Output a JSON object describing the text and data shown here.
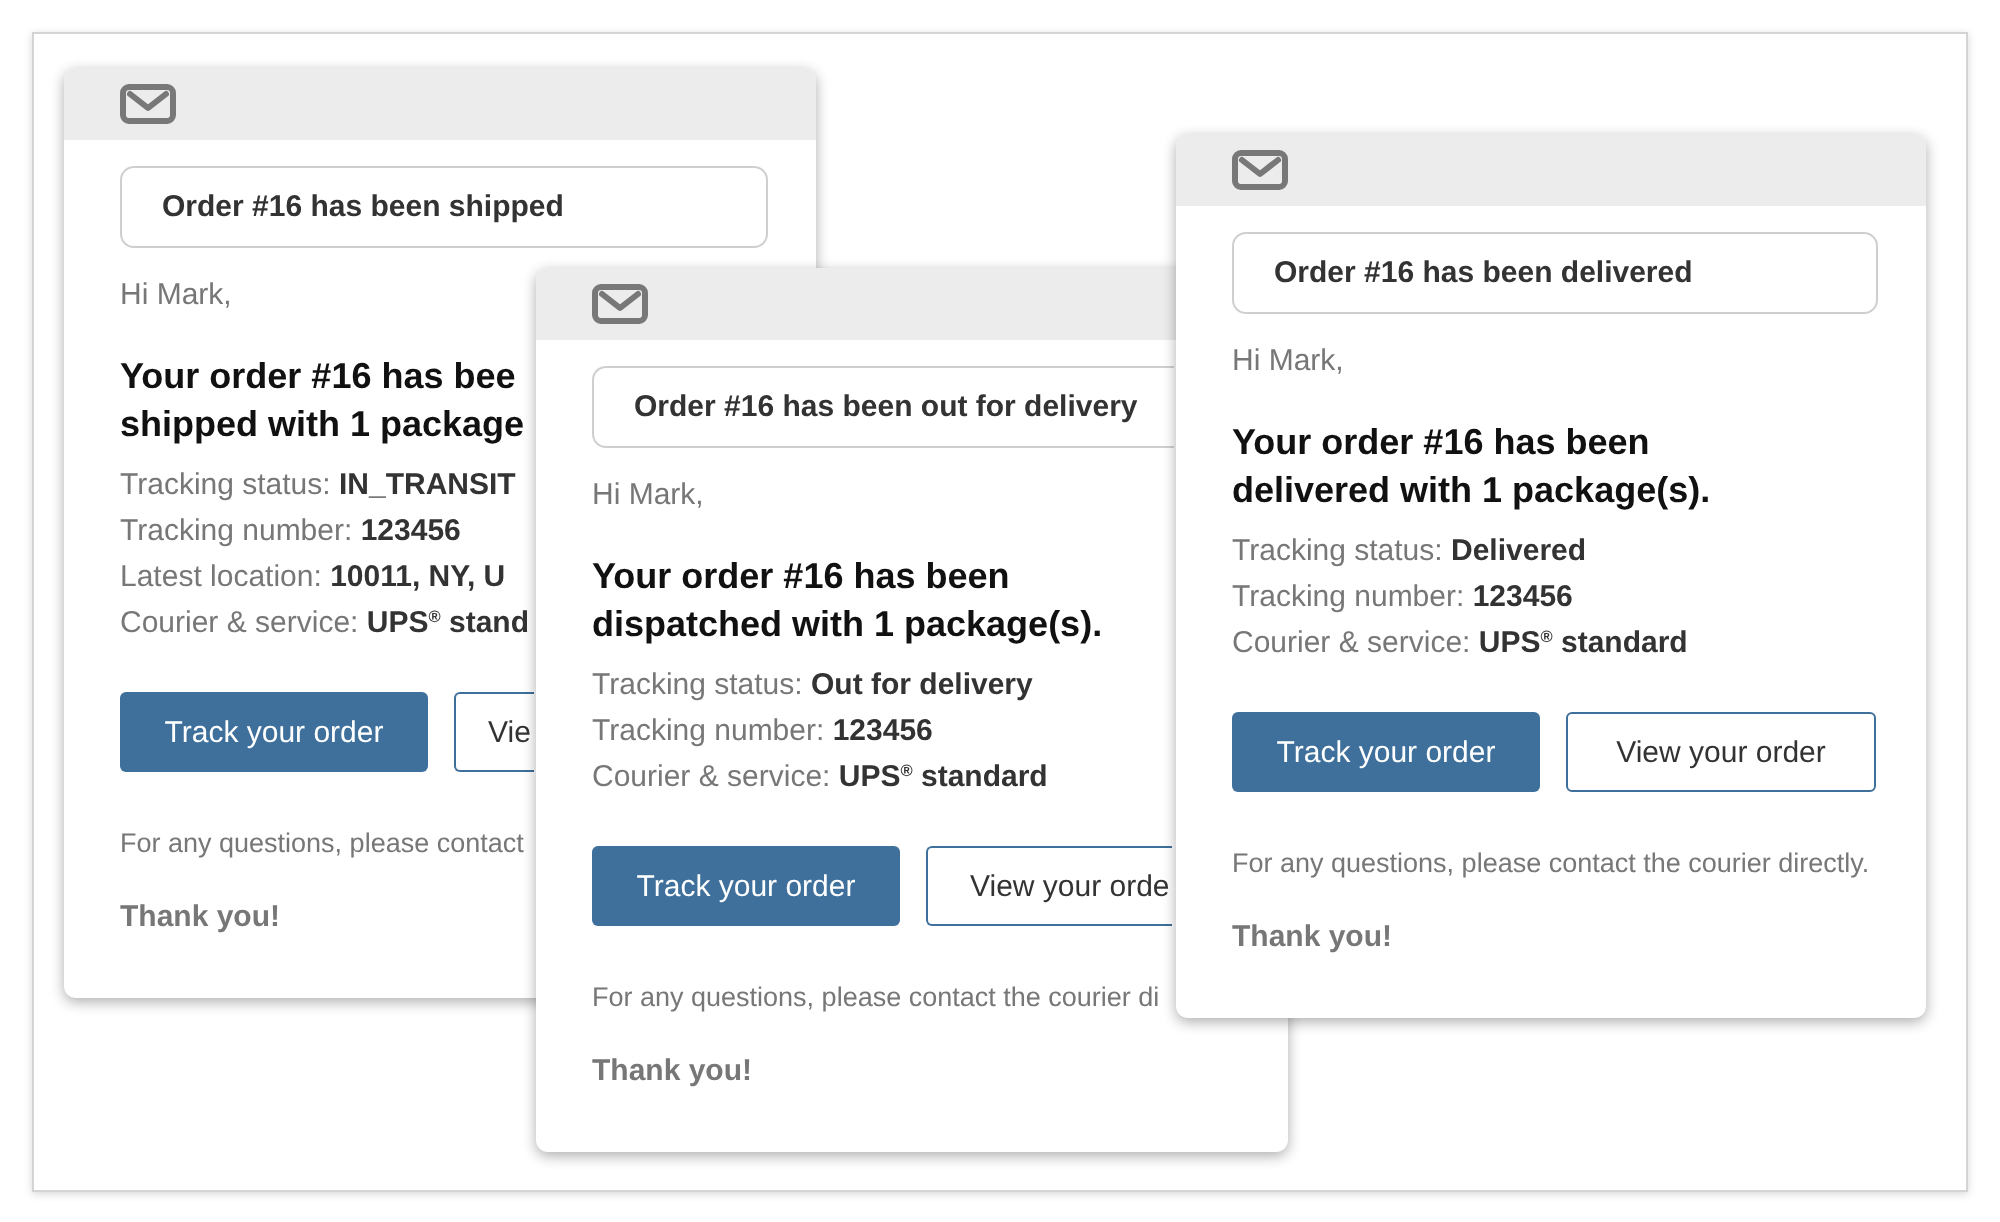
{
  "emails": [
    {
      "subject": "Order #16 has been shipped",
      "greeting": "Hi Mark,",
      "heading_lines": [
        "Your order #16 has bee",
        "shipped with 1 package"
      ],
      "details": [
        {
          "label": "Tracking status:",
          "value": "IN_TRANSIT"
        },
        {
          "label": "Tracking number:",
          "value": "123456"
        },
        {
          "label": "Latest location:",
          "value": "10011, NY, U"
        },
        {
          "label": "Courier & service:",
          "value": "UPS$^{®}$ stand"
        }
      ],
      "buttons": [
        {
          "kind": "primary",
          "label": "Track your order"
        },
        {
          "kind": "secondary",
          "label": "Vie"
        }
      ],
      "note": "For any questions, please contact",
      "closing": "Thank you!"
    },
    {
      "subject": "Order #16 has been out for delivery",
      "greeting": "Hi Mark,",
      "heading_lines": [
        "Your order #16 has been",
        "dispatched with 1 package(s)."
      ],
      "details": [
        {
          "label": "Tracking status:",
          "value": "Out for delivery"
        },
        {
          "label": "Tracking number:",
          "value": "123456"
        },
        {
          "label": "Courier & service:",
          "value": "UPS$^{®}$ standard"
        }
      ],
      "buttons": [
        {
          "kind": "primary",
          "label": "Track your order"
        },
        {
          "kind": "secondary",
          "label": "View your orde"
        }
      ],
      "note": "For any questions, please contact the courier di",
      "closing": "Thank you!"
    },
    {
      "subject": "Order #16 has been delivered",
      "greeting": "Hi Mark,",
      "heading_lines": [
        "Your order #16 has been",
        "delivered with 1 package(s)."
      ],
      "details": [
        {
          "label": "Tracking status:",
          "value": "Delivered"
        },
        {
          "label": "Tracking number:",
          "value": "123456"
        },
        {
          "label": "Courier & service:",
          "value": "UPS$^{®}$ standard"
        }
      ],
      "buttons": [
        {
          "kind": "primary",
          "label": "Track your order"
        },
        {
          "kind": "secondary",
          "label": "View your order"
        }
      ],
      "note": "For any questions, please contact the courier directly.",
      "closing": "Thank you!"
    }
  ]
}
